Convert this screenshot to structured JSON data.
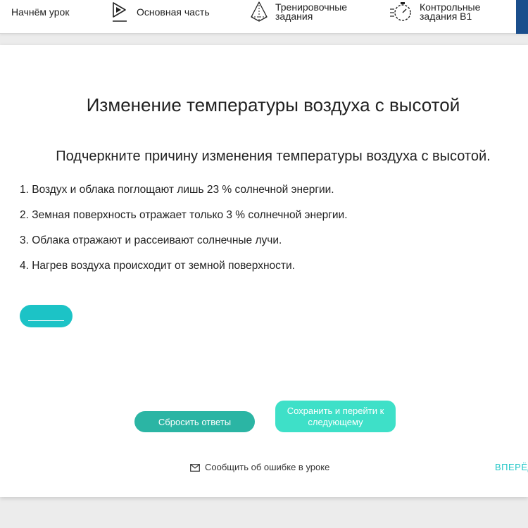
{
  "nav": {
    "items": [
      {
        "label": "Начнём урок",
        "icon": "lightbulb-icon"
      },
      {
        "label": "Основная часть",
        "icon": "play-icon"
      },
      {
        "label_line1": "Тренировочные",
        "label_line2": "задания",
        "icon": "pyramid-icon"
      },
      {
        "label_line1": "Контрольные",
        "label_line2": "задания В1",
        "icon": "stopwatch-icon"
      }
    ],
    "accent_color": "#1a4e8c"
  },
  "lesson": {
    "title": "Изменение температуры воздуха с высотой",
    "question": "Подчеркните причину изменения температуры воздуха с высотой.",
    "options": [
      "1. Воздух и облака поглощают лишь 23 % солнечной энергии.",
      "2. Земная поверхность отражает только 3 % солнечной энергии.",
      "3. Облака отражают и рассеивают солнечные лучи.",
      "4. Нагрев воздуха происходит от земной поверхности."
    ],
    "answer_placeholder": "______"
  },
  "actions": {
    "reset_label": "Сбросить ответы",
    "save_label": "Сохранить и перейти к следующему",
    "report_label": "Сообщить об ошибке в уроке",
    "forward_label": "ВПЕРЁД"
  },
  "colors": {
    "teal": "#1cc3c6",
    "reset_button": "#2bb5a4",
    "save_button": "#3ee0c8"
  }
}
